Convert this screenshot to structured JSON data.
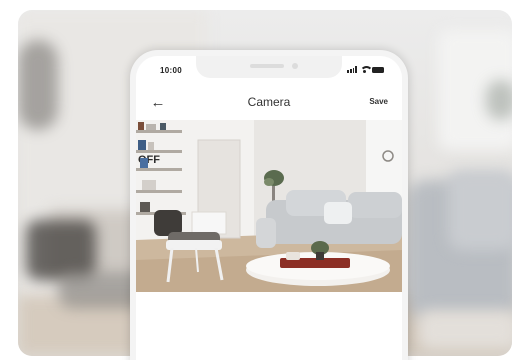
{
  "phone": {
    "status_time": "10:00",
    "title": "Camera",
    "back_icon": "arrow-left-icon",
    "save_label": "Save"
  },
  "camera_feed": {
    "wall_text": "OFF"
  },
  "colors": {
    "background_wall": "#e9e7e4",
    "sofa": "#c6c9cd",
    "floor": "#c9b49b",
    "phone_frame": "#f4f4f4"
  }
}
